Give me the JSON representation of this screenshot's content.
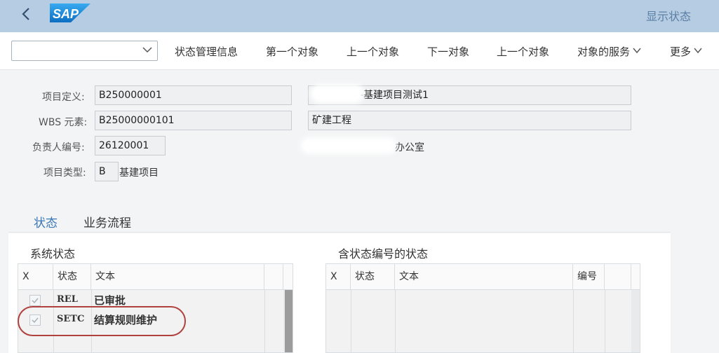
{
  "shell": {
    "title": "显示状态",
    "logo_text": "SAP",
    "back_icon": "chevron-left-icon",
    "brand_color": "#1a8cd8"
  },
  "toolbar": {
    "dropdown_value": "",
    "buttons": [
      "状态管理信息",
      "第一个对象",
      "上一个对象",
      "下一对象",
      "上一个对象",
      "对象的服务",
      "更多"
    ]
  },
  "form": {
    "project_def": {
      "label": "项目定义:",
      "value": "B250000001",
      "desc": "-基建项目测试1"
    },
    "wbs": {
      "label": "WBS 元素:",
      "value": "B25000000101",
      "desc": "矿建工程"
    },
    "person": {
      "label": "负责人编号:",
      "value": "26120001",
      "desc": "办公室"
    },
    "proj_type": {
      "label": "项目类型:",
      "value": "B",
      "desc": "基建项目"
    }
  },
  "tabs": [
    "状态",
    "业务流程"
  ],
  "system_status": {
    "title": "系统状态",
    "columns": [
      "X",
      "状态",
      "文本"
    ],
    "rows": [
      {
        "checked": true,
        "status": "REL",
        "text": "已审批"
      },
      {
        "checked": true,
        "status": "SETC",
        "text": "结算规则维护"
      }
    ]
  },
  "user_status": {
    "title": "含状态编号的状态",
    "columns": [
      "X",
      "状态",
      "文本",
      "编号"
    ]
  }
}
